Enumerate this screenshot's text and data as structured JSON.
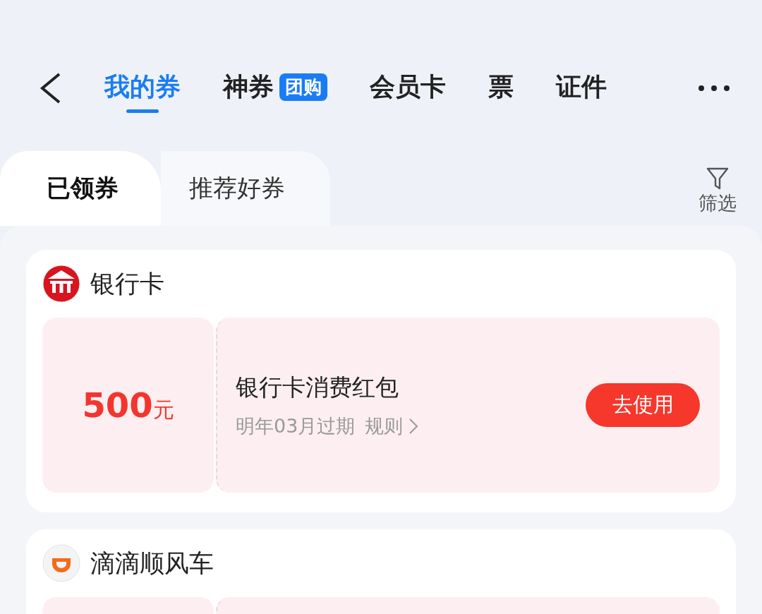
{
  "nav": {
    "tabs": [
      {
        "label": "我的券",
        "selected": true
      },
      {
        "label": "神券",
        "badge": "团购",
        "selected": false
      },
      {
        "label": "会员卡",
        "selected": false
      },
      {
        "label": "票",
        "selected": false
      },
      {
        "label": "证件",
        "selected": false
      }
    ]
  },
  "subtabs": [
    {
      "label": "已领券",
      "selected": true
    },
    {
      "label": "推荐好券",
      "selected": false
    }
  ],
  "filter": {
    "label": "筛选"
  },
  "groups": [
    {
      "name": "银行卡",
      "kind": "bank",
      "coupons": [
        {
          "amount": "500",
          "unit": "元",
          "title": "银行卡消费红包",
          "expiry": "明年03月过期",
          "rule": "规则",
          "action": "去使用"
        }
      ]
    },
    {
      "name": "滴滴顺风车",
      "kind": "car",
      "coupon_cut_off": true
    }
  ]
}
